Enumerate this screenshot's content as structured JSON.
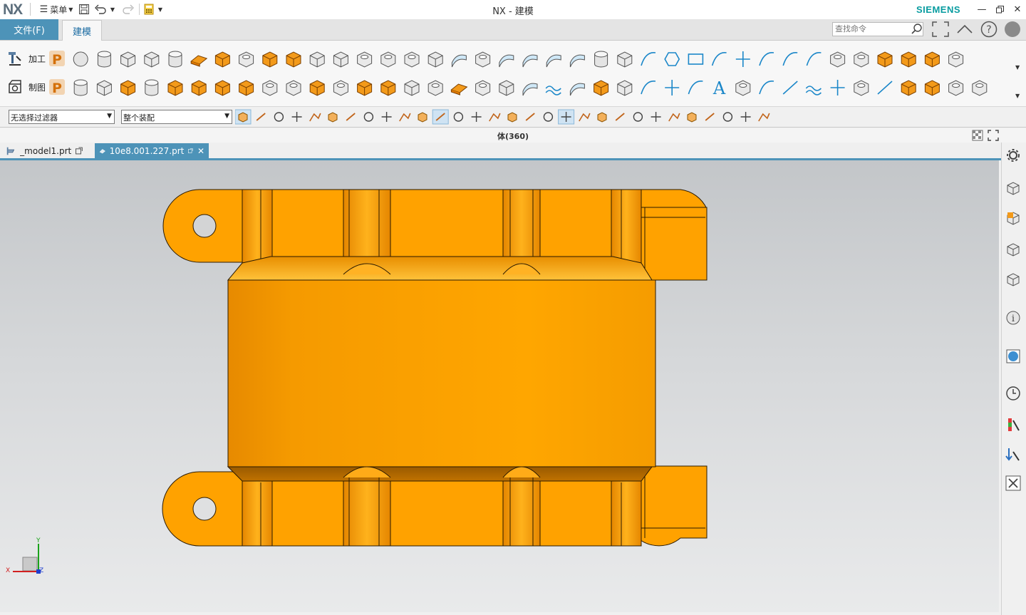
{
  "app": {
    "logo": "NX",
    "window_title": "NX - 建模",
    "brand": "SIEMENS",
    "brand_color": "#089ca0",
    "accent_color": "#4d93b8",
    "model_color": "#ffa200"
  },
  "quick_access": {
    "menu_label": "菜单",
    "menu_icon": "hamburger-icon"
  },
  "ribbon_tabs": [
    {
      "label": "文件(F)",
      "active": false
    },
    {
      "label": "建模",
      "active": true
    }
  ],
  "search": {
    "placeholder": "查找命令"
  },
  "ribbon_groups": [
    {
      "label": "加工",
      "icon": "manufacturing-icon"
    },
    {
      "label": "制图",
      "icon": "drafting-icon"
    }
  ],
  "filters": {
    "selection_filter": "无选择过滤器",
    "scope": "整个装配"
  },
  "status": {
    "text": "体(360)"
  },
  "doc_tabs": [
    {
      "label": "_model1.prt",
      "active": false
    },
    {
      "label": "10e8.001.227.prt",
      "active": true
    }
  ],
  "axes": {
    "x": "X",
    "y": "Y",
    "z": "Z"
  },
  "right_sidebar_icons": [
    "settings-icon",
    "assembly-navigator-icon",
    "constraint-navigator-icon",
    "part-navigator-icon",
    "reuse-library-icon",
    "info-icon",
    "web-browser-icon",
    "history-icon",
    "palette-icon",
    "roles-icon",
    "tools-icon"
  ]
}
